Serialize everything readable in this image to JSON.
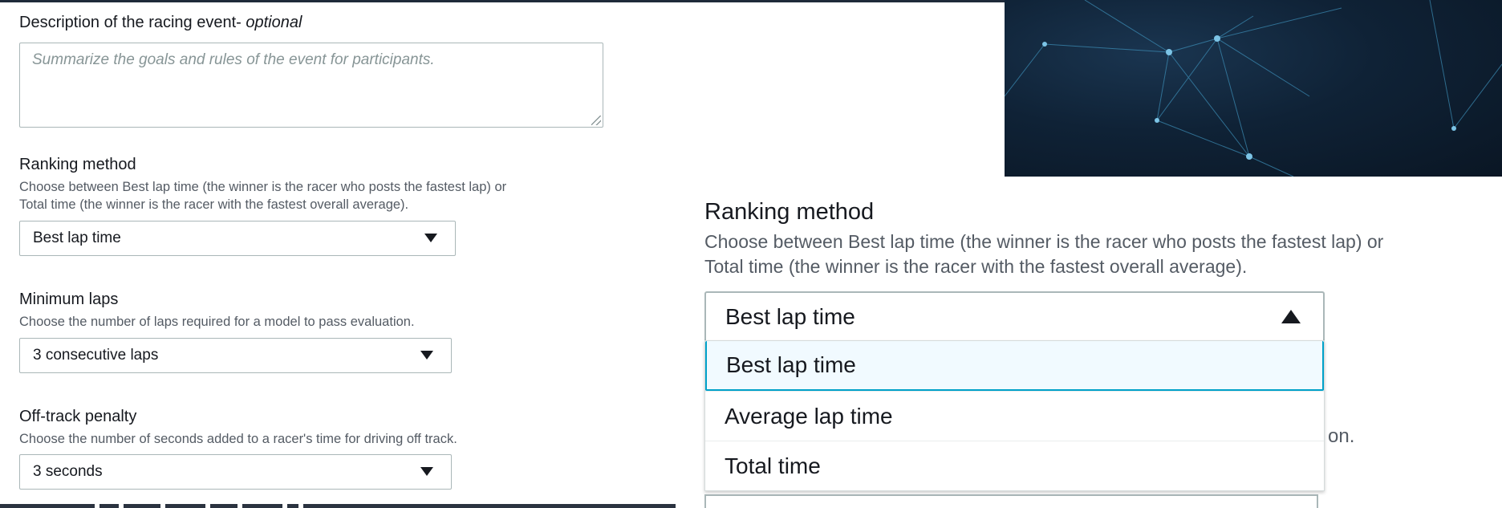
{
  "description": {
    "label": "Description of the racing event- ",
    "optional": "optional",
    "placeholder": "Summarize the goals and rules of the event for participants."
  },
  "ranking": {
    "label": "Ranking method",
    "hint_line1": "Choose between Best lap time (the winner is the racer who posts the fastest lap) or",
    "hint_line2": "Total time (the winner is the racer with the fastest overall average).",
    "selected": "Best lap time"
  },
  "minimum_laps": {
    "label": "Minimum laps",
    "hint": "Choose the number of laps required for a model to pass evaluation.",
    "selected": "3 consecutive laps"
  },
  "offtrack": {
    "label": "Off-track penalty",
    "hint": "Choose the number of seconds added to a racer's time for driving off track.",
    "selected": "3 seconds"
  },
  "zoom": {
    "label": "Ranking method",
    "hint_line1": "Choose between Best lap time (the winner is the racer who posts the fastest lap) or",
    "hint_line2": "Total time (the winner is the racer with the fastest overall average).",
    "selected": "Best lap time",
    "options": [
      "Best lap time",
      "Average lap time",
      "Total time"
    ],
    "peek_text": "on."
  },
  "colors": {
    "focus_border": "#00a1c9",
    "selected_bg": "#f1faff",
    "hero_bg": "#0f2236"
  }
}
